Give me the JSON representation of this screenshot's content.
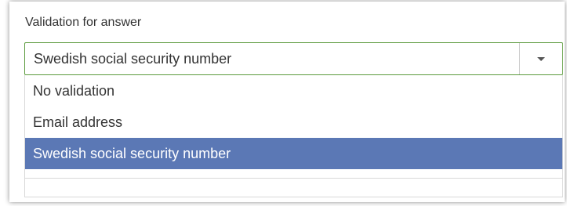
{
  "field": {
    "label": "Validation for answer",
    "selected_value": "Swedish social security number"
  },
  "dropdown": {
    "options": [
      {
        "label": "No validation",
        "selected": false
      },
      {
        "label": "Email address",
        "selected": false
      },
      {
        "label": "Swedish social security number",
        "selected": true
      }
    ]
  },
  "colors": {
    "focus_border": "#5a9a3c",
    "selected_background": "#5b78b5",
    "selected_text": "#ffffff"
  },
  "icons": {
    "dropdown_arrow": "chevron-down-icon"
  }
}
